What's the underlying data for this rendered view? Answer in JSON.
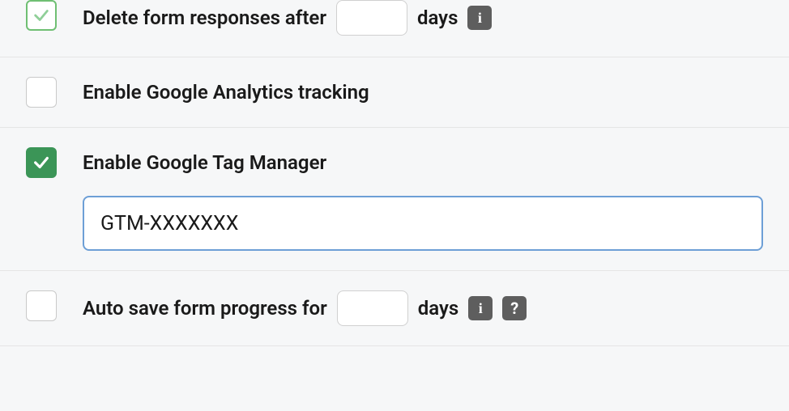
{
  "settings": {
    "deleteResponses": {
      "checked": true,
      "label_before": "Delete form responses after",
      "value": "",
      "label_after": "days",
      "info": "i"
    },
    "googleAnalytics": {
      "checked": false,
      "label": "Enable Google Analytics tracking"
    },
    "googleTagManager": {
      "checked": true,
      "label": "Enable Google Tag Manager",
      "value": "GTM-XXXXXXX"
    },
    "autoSave": {
      "checked": false,
      "label_before": "Auto save form progress for",
      "value": "",
      "label_after": "days",
      "info": "i",
      "help": "?"
    }
  }
}
